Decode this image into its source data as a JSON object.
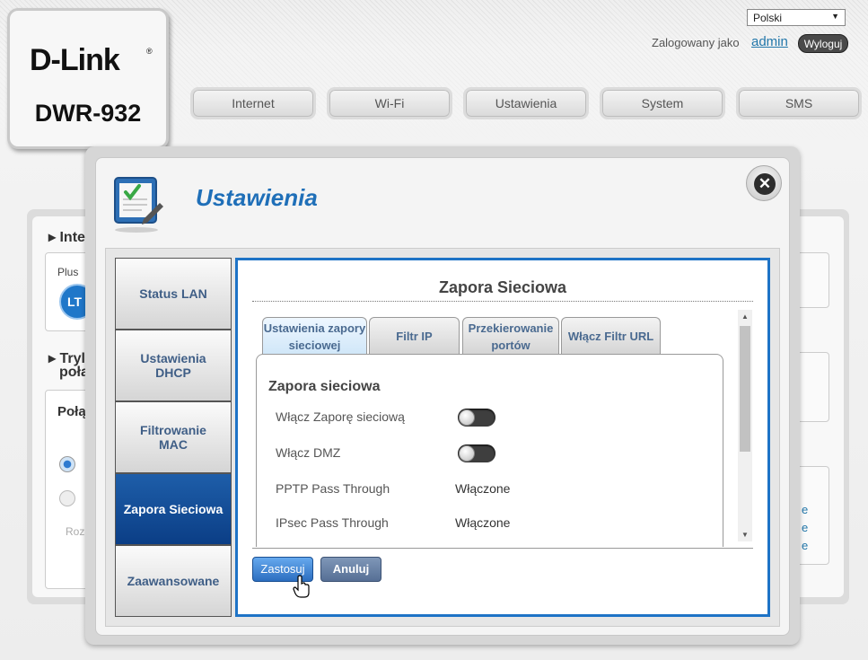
{
  "header": {
    "brand": "D-Link",
    "model": "DWR-932",
    "language": "Polski",
    "logged_in_as": "Zalogowany jako",
    "user": "admin",
    "logout": "Wyloguj"
  },
  "nav": [
    "Internet",
    "Wi-Fi",
    "Ustawienia",
    "System",
    "SMS"
  ],
  "background": {
    "left_texts": [
      "Inte",
      "Plus",
      "LT",
      "Tryl",
      "poła",
      "Połą",
      "Roz"
    ],
    "right_texts": [
      "e",
      "e",
      "e"
    ]
  },
  "modal": {
    "title": "Ustawienia",
    "sidebar": [
      {
        "label": "Status LAN",
        "active": false
      },
      {
        "label": "Ustawienia DHCP",
        "active": false
      },
      {
        "label": "Filtrowanie MAC",
        "active": false
      },
      {
        "label": "Zapora Sieciowa",
        "active": true
      },
      {
        "label": "Zaawansowane",
        "active": false
      }
    ],
    "content_title": "Zapora Sieciowa",
    "tabs": [
      {
        "label": "Ustawienia zapory sieciowej",
        "active": true
      },
      {
        "label": "Filtr IP",
        "active": false
      },
      {
        "label": "Przekierowanie portów",
        "active": false
      },
      {
        "label": "Włącz Filtr URL",
        "active": false
      }
    ],
    "section_title": "Zapora sieciowa",
    "rows": [
      {
        "label": "Włącz Zaporę sieciową",
        "type": "toggle",
        "on": false
      },
      {
        "label": "Włącz DMZ",
        "type": "toggle",
        "on": false
      },
      {
        "label": "PPTP Pass Through",
        "type": "text",
        "value": "Włączone"
      },
      {
        "label": "IPsec Pass Through",
        "type": "text",
        "value": "Włączone"
      }
    ],
    "buttons": {
      "apply": "Zastosuj",
      "cancel": "Anuluj"
    }
  },
  "colors": {
    "accent": "#1f6fb8",
    "active_sidebar": "#0b3e86",
    "content_border": "#1e73c6"
  }
}
